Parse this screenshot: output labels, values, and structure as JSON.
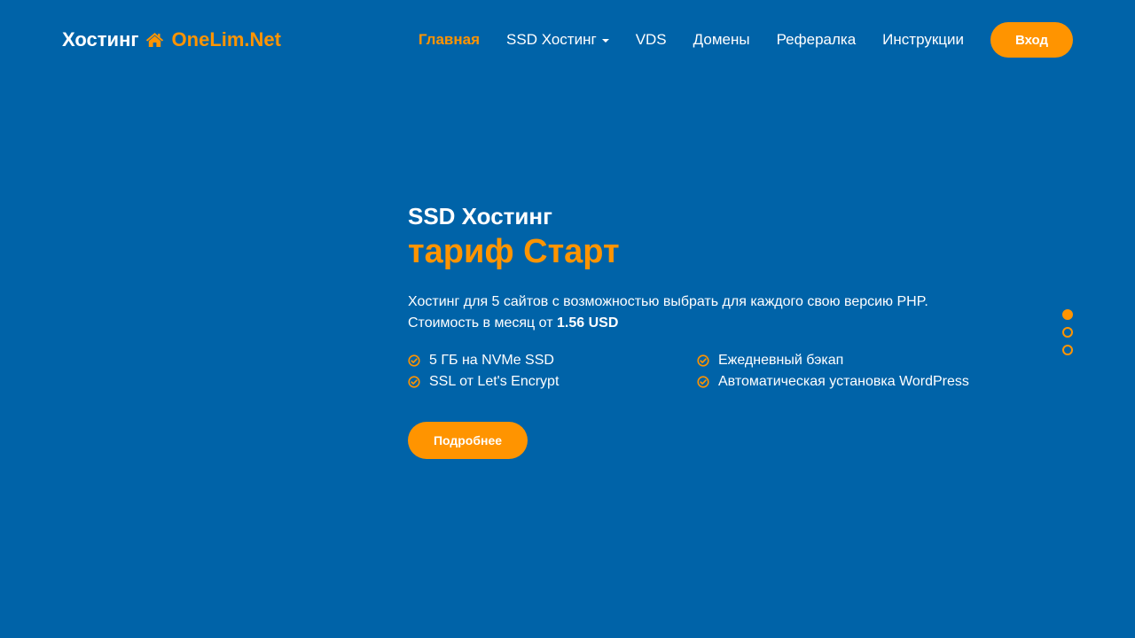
{
  "logo": {
    "word": "Хостинг",
    "icon": "home-icon",
    "brand": "OneLim.Net"
  },
  "nav": {
    "items": [
      {
        "label": "Главная",
        "active": true
      },
      {
        "label": "SSD Хостинг",
        "dropdown": true
      },
      {
        "label": "VDS"
      },
      {
        "label": "Домены"
      },
      {
        "label": "Рефералка"
      },
      {
        "label": "Инструкции"
      }
    ],
    "login_label": "Вход"
  },
  "hero": {
    "subtitle": "SSD Хостинг",
    "title": "тариф Старт",
    "description_line1": "Хостинг для 5 сайтов с возможностью выбрать для каждого свою версию PHP.",
    "price_prefix": "Стоимость в месяц от",
    "price_value": "1.56 USD",
    "features": [
      "5 ГБ на NVMe SSD",
      "Ежедневный бэкап",
      "SSL от Let's Encrypt",
      "Автоматическая установка WordPress"
    ],
    "more_label": "Подробнее"
  },
  "slider": {
    "count": 3,
    "active_index": 0
  },
  "colors": {
    "background": "#0063a8",
    "accent": "#ff9400",
    "text": "#ffffff"
  }
}
